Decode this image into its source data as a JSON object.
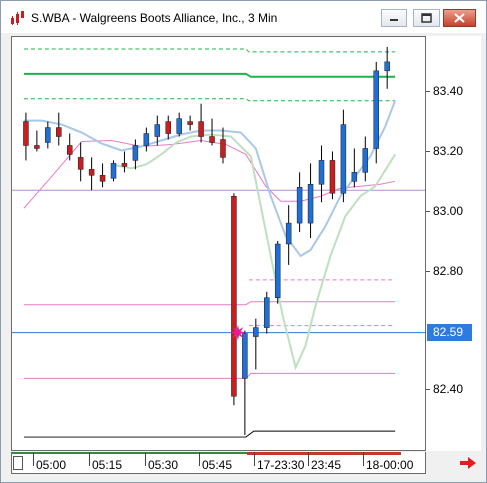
{
  "window": {
    "title": "S.WBA - Walgreens Boots Alliance, Inc., 3 Min"
  },
  "icons": {
    "app": "chart-app-icon",
    "minimize": "minimize-icon",
    "maximize": "maximize-icon",
    "close": "close-icon",
    "scroll_right": "arrow-right-icon"
  },
  "colors": {
    "up_candle": "#1f6fd6",
    "down_candle": "#c81e1e",
    "green_lines": "#1db34a",
    "pink_lines": "#e879c8",
    "last_price": "#2d7be0",
    "marker": "#e0209a"
  },
  "price_axis": {
    "ticks": [
      "83.40",
      "83.20",
      "83.00",
      "82.80",
      "82.40"
    ],
    "last_price_tag": "82.59"
  },
  "time_axis": {
    "labels": [
      "05:00",
      "05:15",
      "05:30",
      "05:45",
      "17-23:30",
      "23:45",
      "18-00:00"
    ]
  },
  "chart_data": {
    "type": "candlestick",
    "title": "S.WBA - Walgreens Boots Alliance, Inc., 3 Min",
    "ylim": [
      82.24,
      83.58
    ],
    "candles": [
      {
        "o": 83.3,
        "h": 83.33,
        "l": 83.17,
        "c": 83.22
      },
      {
        "o": 83.22,
        "h": 83.27,
        "l": 83.2,
        "c": 83.21
      },
      {
        "o": 83.23,
        "h": 83.3,
        "l": 83.21,
        "c": 83.28
      },
      {
        "o": 83.28,
        "h": 83.33,
        "l": 83.22,
        "c": 83.25
      },
      {
        "o": 83.22,
        "h": 83.26,
        "l": 83.17,
        "c": 83.19
      },
      {
        "o": 83.18,
        "h": 83.23,
        "l": 83.1,
        "c": 83.14
      },
      {
        "o": 83.14,
        "h": 83.18,
        "l": 83.07,
        "c": 83.12
      },
      {
        "o": 83.12,
        "h": 83.16,
        "l": 83.08,
        "c": 83.1
      },
      {
        "o": 83.11,
        "h": 83.17,
        "l": 83.1,
        "c": 83.16
      },
      {
        "o": 83.16,
        "h": 83.2,
        "l": 83.13,
        "c": 83.15
      },
      {
        "o": 83.17,
        "h": 83.24,
        "l": 83.14,
        "c": 83.22
      },
      {
        "o": 83.22,
        "h": 83.28,
        "l": 83.2,
        "c": 83.26
      },
      {
        "o": 83.25,
        "h": 83.32,
        "l": 83.22,
        "c": 83.29
      },
      {
        "o": 83.3,
        "h": 83.32,
        "l": 83.24,
        "c": 83.26
      },
      {
        "o": 83.26,
        "h": 83.33,
        "l": 83.25,
        "c": 83.31
      },
      {
        "o": 83.3,
        "h": 83.32,
        "l": 83.27,
        "c": 83.29
      },
      {
        "o": 83.3,
        "h": 83.36,
        "l": 83.23,
        "c": 83.25
      },
      {
        "o": 83.25,
        "h": 83.31,
        "l": 83.22,
        "c": 83.23
      },
      {
        "o": 83.24,
        "h": 83.28,
        "l": 83.16,
        "c": 83.18
      },
      {
        "o": 83.05,
        "h": 83.06,
        "l": 82.35,
        "c": 82.38
      },
      {
        "o": 82.44,
        "h": 82.6,
        "l": 82.25,
        "c": 82.59
      },
      {
        "o": 82.58,
        "h": 82.64,
        "l": 82.47,
        "c": 82.61
      },
      {
        "o": 82.61,
        "h": 82.73,
        "l": 82.59,
        "c": 82.71
      },
      {
        "o": 82.71,
        "h": 82.9,
        "l": 82.69,
        "c": 82.89
      },
      {
        "o": 82.89,
        "h": 83.02,
        "l": 82.82,
        "c": 82.96
      },
      {
        "o": 82.96,
        "h": 83.13,
        "l": 82.93,
        "c": 83.08
      },
      {
        "o": 82.96,
        "h": 83.16,
        "l": 82.91,
        "c": 83.09
      },
      {
        "o": 83.09,
        "h": 83.22,
        "l": 83.03,
        "c": 83.17
      },
      {
        "o": 83.17,
        "h": 83.2,
        "l": 83.04,
        "c": 83.06
      },
      {
        "o": 83.06,
        "h": 83.34,
        "l": 83.03,
        "c": 83.29
      },
      {
        "o": 83.1,
        "h": 83.21,
        "l": 83.08,
        "c": 83.13
      },
      {
        "o": 83.13,
        "h": 83.25,
        "l": 83.1,
        "c": 83.21
      },
      {
        "o": 83.21,
        "h": 83.5,
        "l": 83.16,
        "c": 83.47
      },
      {
        "o": 83.47,
        "h": 83.55,
        "l": 83.41,
        "c": 83.5
      }
    ]
  }
}
